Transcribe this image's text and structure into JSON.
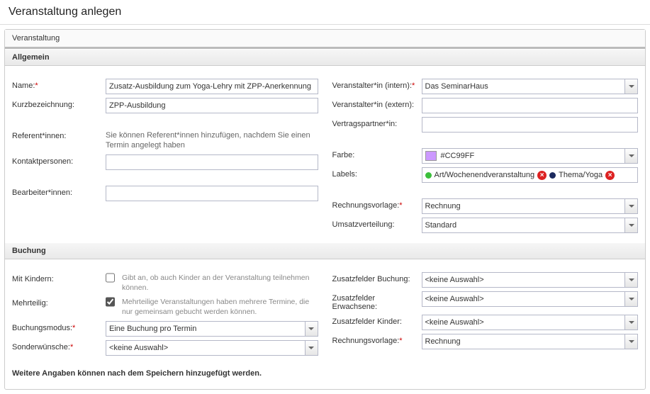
{
  "page": {
    "title": "Veranstaltung anlegen"
  },
  "tab": {
    "label": "Veranstaltung"
  },
  "sections": {
    "allgemein": {
      "title": "Allgemein",
      "name_label": "Name:",
      "name_value": "Zusatz-Ausbildung zum Yoga-Lehry mit ZPP-Anerkennung",
      "kurz_label": "Kurzbezeichnung:",
      "kurz_value": "ZPP-Ausbildung",
      "refer_label": "Referent*innen:",
      "refer_hint": "Sie können Referent*innen hinzufügen, nachdem Sie einen Termin angelegt haben",
      "kontakt_label": "Kontaktpersonen:",
      "bearbeiter_label": "Bearbeiter*innen:",
      "veranst_intern_label": "Veranstalter*in (intern):",
      "veranst_intern_value": "Das SeminarHaus",
      "veranst_extern_label": "Veranstalter*in (extern):",
      "vertrag_label": "Vertragspartner*in:",
      "farbe_label": "Farbe:",
      "farbe_value": "#CC99FF",
      "labels_label": "Labels:",
      "labels": [
        {
          "color": "green",
          "text": "Art/Wochenendveranstaltung"
        },
        {
          "color": "navy",
          "text": "Thema/Yoga"
        }
      ],
      "rechnung_label": "Rechnungsvorlage:",
      "rechnung_value": "Rechnung",
      "umsatz_label": "Umsatzverteilung:",
      "umsatz_value": "Standard"
    },
    "buchung": {
      "title": "Buchung",
      "mitkindern_label": "Mit Kindern:",
      "mitkindern_hint": "Gibt an, ob auch Kinder an der Veranstaltung teilnehmen können.",
      "mitkindern_checked": false,
      "mehrteilig_label": "Mehrteilig:",
      "mehrteilig_hint": "Mehrteilige Veranstaltungen haben mehrere Termine, die nur gemeinsam gebucht werden können.",
      "mehrteilig_checked": true,
      "modus_label": "Buchungsmodus:",
      "modus_value": "Eine Buchung pro Termin",
      "sonder_label": "Sonderwünsche:",
      "sonder_value": "<keine Auswahl>",
      "zf_buchung_label": "Zusatzfelder Buchung:",
      "zf_buchung_value": "<keine Auswahl>",
      "zf_erw_label": "Zusatzfelder Erwachsene:",
      "zf_erw_value": "<keine Auswahl>",
      "zf_kinder_label": "Zusatzfelder Kinder:",
      "zf_kinder_value": "<keine Auswahl>",
      "rechnung_label": "Rechnungsvorlage:",
      "rechnung_value": "Rechnung"
    }
  },
  "footer": {
    "note": "Weitere Angaben können nach dem Speichern hinzugefügt werden."
  }
}
